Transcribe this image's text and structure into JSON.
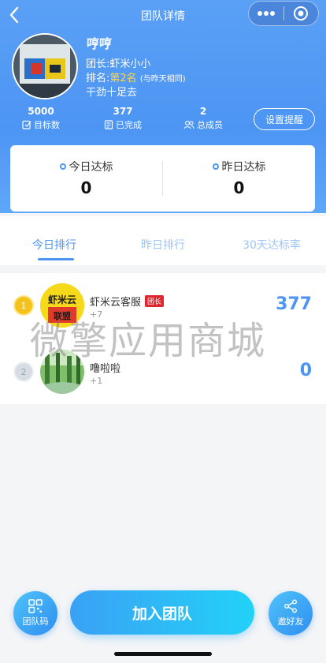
{
  "navbar": {
    "title": "团队详情"
  },
  "team": {
    "name": "哼哼",
    "leader": "团长:虾米小小",
    "rank_prefix": "排名:",
    "rank_value": "第2名",
    "rank_note": "(与昨天相同)",
    "slogan": "干劲十足去"
  },
  "stats": [
    {
      "value": "5000",
      "label": "目标数",
      "icon": "target-edit-icon"
    },
    {
      "value": "377",
      "label": "已完成",
      "icon": "done-list-icon"
    },
    {
      "value": "2",
      "label": "总成员",
      "icon": "members-icon"
    }
  ],
  "remind_button": "设置提醒",
  "summary": {
    "today_label": "今日达标",
    "today_value": "0",
    "yesterday_label": "昨日达标",
    "yesterday_value": "0"
  },
  "tabs": [
    {
      "label": "今日排行",
      "active": true
    },
    {
      "label": "昨日排行",
      "active": false
    },
    {
      "label": "30天达标率",
      "active": false
    }
  ],
  "ranking": [
    {
      "rank": "1",
      "name": "虾米云客服",
      "badge": "团长",
      "sub": "+7",
      "score": "377",
      "avatar_text_1": "虾米云",
      "avatar_text_2": "联盟"
    },
    {
      "rank": "2",
      "name": "噜啦啦",
      "badge": "",
      "sub": "+1",
      "score": "0"
    }
  ],
  "watermark": "微擎应用商城",
  "bottom": {
    "team_code": "团队码",
    "join": "加入团队",
    "invite": "邀好友"
  },
  "colors": {
    "primary": "#4d95f3",
    "gold": "#ffd54a",
    "badge_red": "#e0262f"
  }
}
